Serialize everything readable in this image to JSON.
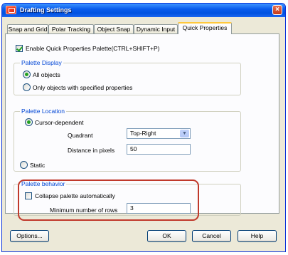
{
  "window": {
    "title": "Drafting Settings",
    "close_glyph": "×"
  },
  "tabs": [
    {
      "label": "Snap and Grid"
    },
    {
      "label": "Polar Tracking"
    },
    {
      "label": "Object Snap"
    },
    {
      "label": "Dynamic Input"
    },
    {
      "label": "Quick Properties",
      "active": true
    }
  ],
  "enable_checkbox": {
    "label": "Enable Quick Properties Palette(CTRL+SHIFT+P)",
    "checked": true
  },
  "palette_display": {
    "title": "Palette Display",
    "options": [
      {
        "label": "All objects",
        "selected": true
      },
      {
        "label": "Only objects with specified properties",
        "selected": false
      }
    ]
  },
  "palette_location": {
    "title": "Palette Location",
    "cursor_dependent": {
      "label": "Cursor-dependent",
      "selected": true
    },
    "quadrant": {
      "label": "Quadrant",
      "value": "Top-Right",
      "arrow": "▼"
    },
    "distance": {
      "label": "Distance in pixels",
      "value": "50"
    },
    "static": {
      "label": "Static",
      "selected": false
    }
  },
  "palette_behavior": {
    "title": "Palette behavior",
    "collapse": {
      "label": "Collapse palette automatically",
      "checked": false
    },
    "min_rows": {
      "label": "Minimum number of rows",
      "value": "3"
    }
  },
  "buttons": {
    "options": "Options...",
    "ok": "OK",
    "cancel": "Cancel",
    "help": "Help"
  },
  "colors": {
    "titlebar": "#0a5cec",
    "group_title": "#0046d5",
    "highlight": "#c0392b"
  }
}
